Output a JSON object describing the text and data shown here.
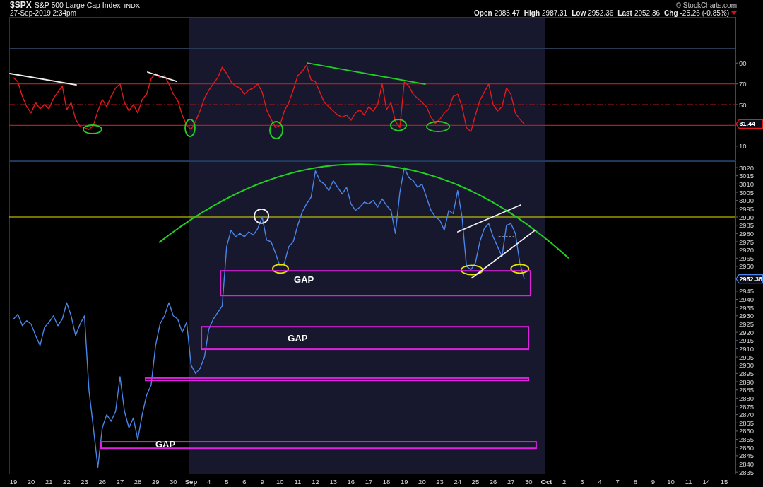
{
  "header": {
    "symbol": "$SPX",
    "name": "S&P 500 Large Cap Index",
    "exchange": "INDX",
    "timestamp": "27-Sep-2019 2:34pm",
    "credit": "© StockCharts.com",
    "quote": [
      {
        "label": "Open",
        "value": "2985.47"
      },
      {
        "label": "High",
        "value": "2987.31"
      },
      {
        "label": "Low",
        "value": "2952.36"
      },
      {
        "label": "Last",
        "value": "2952.36"
      },
      {
        "label": "Chg",
        "value": "-25.26 (-0.85%)"
      }
    ],
    "change_down": true
  },
  "rsi_panel": {
    "last_label": "31.44",
    "chart_data": {
      "type": "line",
      "categories": [
        null,
        null,
        null,
        null,
        null,
        null,
        null,
        null,
        null,
        null,
        null,
        null,
        null,
        null,
        null,
        null,
        null,
        null,
        null,
        null,
        null,
        null,
        null,
        null,
        null,
        null,
        null,
        null,
        null,
        null,
        null,
        null,
        null,
        null,
        null,
        null,
        null,
        null,
        null,
        null,
        null,
        null,
        null,
        null,
        null,
        null,
        null,
        null,
        null,
        null,
        null,
        null,
        null,
        null,
        null,
        null,
        null,
        null,
        null,
        null,
        null,
        null,
        null,
        null,
        null,
        null,
        null,
        null,
        null,
        null,
        null,
        null,
        null,
        null,
        null,
        null,
        null,
        null,
        null,
        null,
        null,
        null,
        null,
        null,
        null,
        null,
        null,
        null,
        null,
        null,
        null,
        null,
        null,
        null,
        null,
        null,
        null,
        null,
        null,
        null,
        null,
        null,
        null,
        null,
        null,
        null,
        null,
        null,
        null,
        null,
        null,
        null,
        null,
        null,
        null,
        null,
        null,
        null,
        null,
        null,
        null,
        null,
        null,
        null,
        null,
        null,
        null,
        null,
        null,
        null,
        null,
        null,
        null,
        null,
        null,
        null,
        null,
        null,
        null,
        null,
        null,
        null,
        null,
        null,
        null,
        null,
        null,
        null,
        null,
        null,
        null,
        null,
        null,
        null,
        null,
        null,
        null,
        null,
        null,
        null,
        null
      ],
      "series": [
        {
          "color": "#e01b1b",
          "values": [
            76,
            72,
            58,
            48,
            42,
            52,
            46,
            50,
            46,
            56,
            62,
            68,
            45,
            52,
            36,
            29,
            28,
            26,
            30,
            44,
            55,
            48,
            58,
            66,
            70,
            52,
            44,
            50,
            42,
            55,
            60,
            75,
            80,
            76,
            78,
            70,
            60,
            54,
            40,
            30,
            26,
            34,
            44,
            56,
            64,
            70,
            76,
            86,
            80,
            72,
            68,
            66,
            60,
            64,
            66,
            70,
            62,
            45,
            36,
            28,
            30,
            44,
            52,
            64,
            78,
            82,
            88,
            74,
            72,
            62,
            52,
            48,
            44,
            40,
            38,
            40,
            35,
            42,
            45,
            40,
            48,
            44,
            50,
            70,
            45,
            52,
            34,
            28,
            72,
            68,
            60,
            56,
            52,
            48,
            38,
            32,
            36,
            42,
            46,
            58,
            60,
            48,
            28,
            24,
            40,
            54,
            62,
            70,
            50,
            44,
            48,
            66,
            60,
            42,
            36,
            31.4,
            null,
            null,
            null,
            null,
            null,
            null,
            null,
            null,
            null,
            null,
            null,
            null,
            null,
            null,
            null,
            null,
            null,
            null,
            null,
            null,
            null,
            null,
            null,
            null,
            null,
            null,
            null,
            null,
            null,
            null,
            null,
            null,
            null,
            null,
            null,
            null,
            null,
            null,
            null,
            null,
            null,
            null,
            null,
            null,
            null
          ]
        }
      ],
      "ylim": [
        -4.4,
        134.4
      ],
      "yticks": [
        10,
        50,
        70,
        90
      ],
      "ref_lines": [
        {
          "axis": "y",
          "value": 70
        },
        {
          "axis": "y",
          "value": 50
        },
        {
          "axis": "y",
          "value": 30
        }
      ]
    }
  },
  "price_panel": {
    "last_label": "2952.36",
    "chart_data": {
      "type": "line",
      "categories": [
        "19",
        null,
        null,
        null,
        "20",
        null,
        null,
        null,
        "21",
        null,
        null,
        null,
        "22",
        null,
        null,
        null,
        "23",
        null,
        null,
        null,
        "26",
        null,
        null,
        null,
        "27",
        null,
        null,
        null,
        "28",
        null,
        null,
        null,
        "29",
        null,
        null,
        null,
        "30",
        null,
        null,
        null,
        "Sep",
        null,
        null,
        null,
        "4",
        null,
        null,
        null,
        "5",
        null,
        null,
        null,
        "6",
        null,
        null,
        null,
        "9",
        null,
        null,
        null,
        "10",
        null,
        null,
        null,
        "11",
        null,
        null,
        null,
        "12",
        null,
        null,
        null,
        "13",
        null,
        null,
        null,
        "16",
        null,
        null,
        null,
        "17",
        null,
        null,
        null,
        "18",
        null,
        null,
        null,
        "19",
        null,
        null,
        null,
        "20",
        null,
        null,
        null,
        "23",
        null,
        null,
        null,
        "24",
        null,
        null,
        null,
        "25",
        null,
        null,
        null,
        "26",
        null,
        null,
        null,
        "27",
        null,
        null,
        null,
        "30",
        null,
        null,
        null,
        "Oct",
        null,
        null,
        null,
        "2",
        null,
        null,
        null,
        "3",
        null,
        null,
        null,
        "4",
        null,
        null,
        null,
        "7",
        null,
        null,
        null,
        "8",
        null,
        null,
        null,
        "9",
        null,
        null,
        null,
        "10",
        null,
        null,
        null,
        "11",
        null,
        null,
        null,
        "14",
        null,
        null,
        null,
        "15"
      ],
      "series": [
        {
          "color": "#4a86e8",
          "values": [
            2928,
            2931,
            2924,
            2927,
            2925,
            2918,
            2912,
            2923,
            2926,
            2930,
            2924,
            2928,
            2938,
            2930,
            2918,
            2925,
            2930,
            2885,
            2862,
            2838,
            2862,
            2870,
            2866,
            2872,
            2893,
            2872,
            2862,
            2868,
            2855,
            2870,
            2882,
            2888,
            2912,
            2925,
            2930,
            2938,
            2930,
            2928,
            2920,
            2926,
            2900,
            2895,
            2898,
            2905,
            2922,
            2928,
            2932,
            2936,
            2972,
            2982,
            2978,
            2980,
            2978,
            2981,
            2979,
            2983,
            2990,
            2976,
            2975,
            2968,
            2960,
            2962,
            2972,
            2975,
            2985,
            2993,
            2998,
            3002,
            3018,
            3012,
            3010,
            3006,
            3012,
            3008,
            3004,
            3008,
            2998,
            2994,
            2996,
            2999,
            2998,
            3000,
            2996,
            3001,
            2997,
            2994,
            2980,
            3005,
            3020,
            3014,
            3012,
            3008,
            3010,
            3002,
            2994,
            2990,
            2988,
            2982,
            2994,
            2992,
            3006,
            2990,
            2960,
            2958,
            2962,
            2975,
            2983,
            2986,
            2978,
            2972,
            2966,
            2985,
            2986,
            2980,
            2962,
            2952.4,
            null,
            null,
            null,
            null,
            null,
            null,
            null,
            null,
            null,
            null,
            null,
            null,
            null,
            null,
            null,
            null,
            null,
            null,
            null,
            null,
            null,
            null,
            null,
            null,
            null,
            null,
            null,
            null,
            null,
            null,
            null,
            null,
            null,
            null,
            null,
            null,
            null,
            null,
            null,
            null,
            null,
            null,
            null,
            null,
            null
          ]
        }
      ],
      "ylim": [
        2833.8,
        3023.9
      ],
      "yticks": [
        2835,
        2840,
        2845,
        2850,
        2855,
        2860,
        2865,
        2870,
        2875,
        2880,
        2885,
        2890,
        2895,
        2900,
        2905,
        2910,
        2915,
        2920,
        2925,
        2930,
        2935,
        2940,
        2945,
        2960,
        2965,
        2970,
        2975,
        2980,
        2985,
        2990,
        2995,
        3000,
        3005,
        3010,
        3015,
        3020
      ],
      "ref_lines": [
        {
          "axis": "y",
          "value": 2990
        }
      ],
      "annotations": [
        "GAP",
        "GAP",
        "GAP"
      ]
    }
  }
}
